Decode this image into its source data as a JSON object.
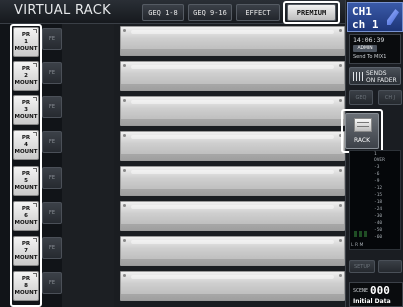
{
  "header": {
    "title": "VIRTUAL RACK",
    "tabs": [
      {
        "label": "GEQ 1-8",
        "active": false
      },
      {
        "label": "GEQ 9-16",
        "active": false
      },
      {
        "label": "EFFECT",
        "active": false
      },
      {
        "label": "PREMIUM",
        "active": true
      }
    ]
  },
  "rack": {
    "mounts": [
      {
        "line1": "PR",
        "line2": "1",
        "line3": "MOUNT"
      },
      {
        "line1": "PR",
        "line2": "2",
        "line3": "MOUNT"
      },
      {
        "line1": "PR",
        "line2": "3",
        "line3": "MOUNT"
      },
      {
        "line1": "PR",
        "line2": "4",
        "line3": "MOUNT"
      },
      {
        "line1": "PR",
        "line2": "5",
        "line3": "MOUNT"
      },
      {
        "line1": "PR",
        "line2": "6",
        "line3": "MOUNT"
      },
      {
        "line1": "PR",
        "line2": "7",
        "line3": "MOUNT"
      },
      {
        "line1": "PR",
        "line2": "8",
        "line3": "MOUNT"
      }
    ],
    "side_label": "FE"
  },
  "channel": {
    "line1": "CH1",
    "line2": "ch 1"
  },
  "status": {
    "time": "14:06:39",
    "user": "ADMIN",
    "send_target": "Send To MIX1"
  },
  "sends_button": {
    "line1": "SENDS",
    "line2": "ON FADER"
  },
  "dim_buttons": [
    "GEQ",
    "CH J"
  ],
  "rack_button": {
    "label": "RACK"
  },
  "meter": {
    "scale": [
      "1",
      "OVER",
      "-3",
      "-6",
      "-9",
      "-12",
      "-15",
      "-18",
      "-24",
      "-30",
      "-40",
      "-50",
      "-60"
    ],
    "channels_label": "L R M"
  },
  "setup_button": {
    "label": "SETUP"
  },
  "scene": {
    "label": "SCENE",
    "number": "000",
    "name": "Initial Data"
  },
  "colors": {
    "accent": "#2d4fa0",
    "highlight": "#ffffff"
  }
}
